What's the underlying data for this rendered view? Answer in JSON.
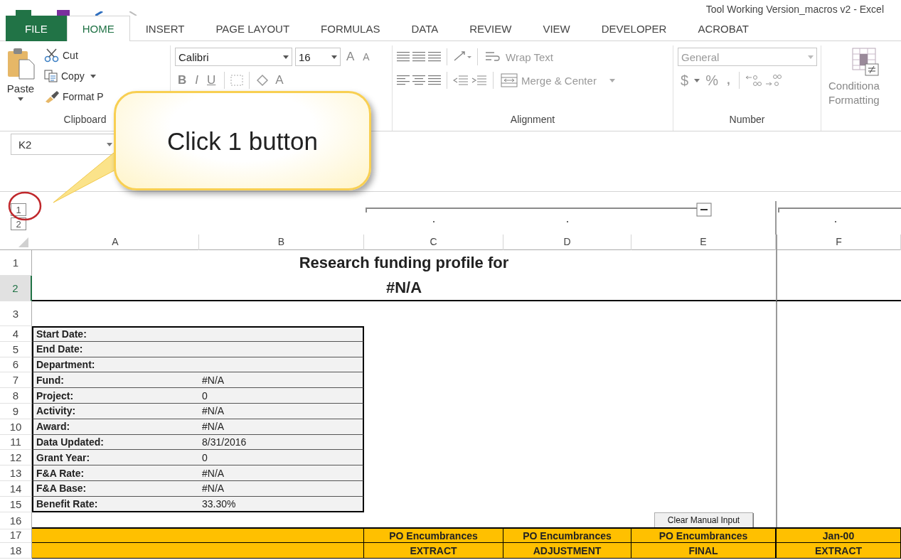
{
  "window": {
    "title": "Tool Working Version_macros v2 - Excel"
  },
  "ribbon_tabs": [
    {
      "label": "FILE",
      "kind": "file",
      "selected": false
    },
    {
      "label": "HOME",
      "kind": "tab",
      "selected": true
    },
    {
      "label": "INSERT",
      "kind": "tab",
      "selected": false
    },
    {
      "label": "PAGE LAYOUT",
      "kind": "tab",
      "selected": false
    },
    {
      "label": "FORMULAS",
      "kind": "tab",
      "selected": false
    },
    {
      "label": "DATA",
      "kind": "tab",
      "selected": false
    },
    {
      "label": "REVIEW",
      "kind": "tab",
      "selected": false
    },
    {
      "label": "VIEW",
      "kind": "tab",
      "selected": false
    },
    {
      "label": "DEVELOPER",
      "kind": "tab",
      "selected": false
    },
    {
      "label": "ACROBAT",
      "kind": "tab",
      "selected": false
    }
  ],
  "clipboard": {
    "paste": "Paste",
    "cut": "Cut",
    "copy": "Copy",
    "format_painter": "Format P",
    "label": "Clipboard"
  },
  "font": {
    "font_name": "Calibri",
    "font_size": "16",
    "grow_font": "A",
    "shrink_font": "A",
    "bold": "B",
    "italic": "I",
    "underline": "U",
    "font_color": "A"
  },
  "alignment": {
    "disabled": true,
    "wrap_text": "Wrap Text",
    "merge_center": "Merge & Center",
    "label": "Alignment"
  },
  "number": {
    "disabled": true,
    "format": "General",
    "currency": "$",
    "percent": "%",
    "comma": ",",
    "label": "Number"
  },
  "styles": {
    "conditional_formatting": [
      "Conditiona",
      "Formatting"
    ]
  },
  "name_box": {
    "value": "K2"
  },
  "outline": {
    "levels": [
      {
        "label": "1"
      },
      {
        "label": "2"
      }
    ]
  },
  "callout": {
    "text": "Click 1 button"
  },
  "sheet": {
    "columns": [
      {
        "label": "A",
        "selected": false
      },
      {
        "label": "B",
        "selected": false
      },
      {
        "label": "C",
        "selected": false
      },
      {
        "label": "D",
        "selected": false
      },
      {
        "label": "E",
        "selected": false
      },
      {
        "label": "F",
        "selected": false
      }
    ],
    "rows": [
      {
        "number": "1",
        "kind": "title",
        "selected": false,
        "text": "Research funding profile for"
      },
      {
        "number": "2",
        "kind": "title",
        "selected": true,
        "text": "#N/A"
      },
      {
        "number": "3",
        "kind": "blank",
        "selected": false
      },
      {
        "number": "4",
        "kind": "info",
        "selected": false,
        "label": "Start Date:"
      },
      {
        "number": "5",
        "kind": "info",
        "selected": false,
        "label": "End Date:"
      },
      {
        "number": "6",
        "kind": "info",
        "selected": false,
        "label": "Department:"
      },
      {
        "number": "7",
        "kind": "info",
        "selected": false,
        "label": "Fund:",
        "value": "#N/A"
      },
      {
        "number": "8",
        "kind": "info",
        "selected": false,
        "label": "Project:",
        "value": "0"
      },
      {
        "number": "9",
        "kind": "info",
        "selected": false,
        "label": "Activity:",
        "value": "#N/A"
      },
      {
        "number": "10",
        "kind": "info",
        "selected": false,
        "label": "Award:",
        "value": "#N/A"
      },
      {
        "number": "11",
        "kind": "info",
        "selected": false,
        "label": "Data Updated:",
        "value": "8/31/2016"
      },
      {
        "number": "12",
        "kind": "info",
        "selected": false,
        "label": "Grant Year:",
        "value": "0"
      },
      {
        "number": "13",
        "kind": "info",
        "selected": false,
        "label": "F&A Rate:",
        "value": "#N/A"
      },
      {
        "number": "14",
        "kind": "info",
        "selected": false,
        "label": "F&A Base:",
        "value": "#N/A"
      },
      {
        "number": "15",
        "kind": "info",
        "selected": false,
        "label": "Benefit Rate:",
        "value": "33.30%"
      },
      {
        "number": "16",
        "kind": "button",
        "selected": false,
        "button": "Clear Manual Input"
      },
      {
        "number": "17",
        "kind": "header",
        "selected": false,
        "cells": [
          "PO Encumbrances",
          "PO Encumbrances",
          "PO Encumbrances",
          "Jan-00"
        ]
      },
      {
        "number": "18",
        "kind": "header",
        "selected": false,
        "cells": [
          "EXTRACT",
          "ADJUSTMENT",
          "FINAL",
          "EXTRACT"
        ]
      }
    ]
  }
}
